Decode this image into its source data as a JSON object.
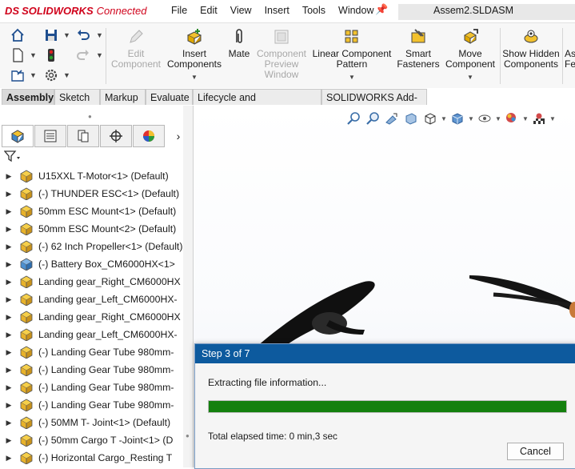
{
  "app": {
    "brand": "SOLIDWORKS",
    "brand_suffix": "Connected",
    "brand_mark": "DS",
    "document_title": "Assem2.SLDASM"
  },
  "menu": [
    "File",
    "Edit",
    "View",
    "Insert",
    "Tools",
    "Window"
  ],
  "ribbon": {
    "buttons": [
      {
        "label": "Edit Component",
        "enabled": false,
        "icon": "edit-component-icon"
      },
      {
        "label": "Insert Components",
        "enabled": true,
        "icon": "insert-components-icon"
      },
      {
        "label": "Mate",
        "enabled": true,
        "icon": "paperclip-icon"
      },
      {
        "label": "Component Preview Window",
        "enabled": false,
        "icon": "preview-window-icon"
      },
      {
        "label": "Linear Component Pattern",
        "enabled": true,
        "icon": "pattern-icon"
      },
      {
        "label": "Smart Fasteners",
        "enabled": true,
        "icon": "fasteners-icon"
      },
      {
        "label": "Move Component",
        "enabled": true,
        "icon": "move-component-icon"
      },
      {
        "label": "Show Hidden Components",
        "enabled": true,
        "icon": "show-hidden-icon"
      }
    ],
    "overflow_label": "As Fe"
  },
  "command_tabs": [
    "Assembly",
    "Sketch",
    "Markup",
    "Evaluate",
    "Lifecycle and Collaboration",
    "SOLIDWORKS Add-Ins"
  ],
  "active_tab": "Assembly",
  "tree": [
    "U15XXL T-Motor<1> (Default)",
    "(-) THUNDER ESC<1> (Default)",
    "50mm ESC Mount<1> (Default)",
    "50mm ESC Mount<2> (Default)",
    "(-) 62 Inch Propeller<1> (Default)",
    "(-) Battery Box_CM6000HX<1>",
    "Landing gear_Right_CM6000HX",
    "Landing gear_Left_CM6000HX-",
    "Landing gear_Right_CM6000HX",
    "Landing gear_Left_CM6000HX-",
    "(-) Landing Gear Tube 980mm-",
    "(-) Landing Gear Tube 980mm-",
    "(-) Landing Gear Tube 980mm-",
    "(-) Landing Gear Tube 980mm-",
    "(-) 50MM T- Joint<1> (Default)",
    "(-) 50mm Cargo T -Joint<1> (D",
    "(-) Horizontal Cargo_Resting T"
  ],
  "progress_dialog": {
    "step_text": "Step 3 of 7",
    "message": "Extracting file information...",
    "progress": 1.0,
    "elapsed": "Total elapsed time: 0 min,3 sec",
    "cancel_label": "Cancel"
  },
  "colors": {
    "brand_red": "#d0021b",
    "dialog_header": "#0d5a9e",
    "progress_green": "#14800e"
  }
}
